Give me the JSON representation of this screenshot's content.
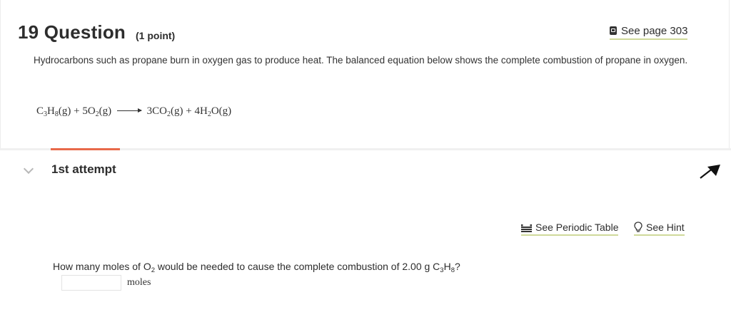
{
  "question": {
    "number": "19 Question",
    "points": "(1 point)",
    "see_page": "See page 303",
    "prompt": "Hydrocarbons such as propane burn in oxygen gas to produce heat. The balanced equation below shows the complete combustion of propane in oxygen.",
    "equation": {
      "reactant1": {
        "a": "C",
        "s1": "3",
        "b": "H",
        "s2": "8",
        "state": "(g)"
      },
      "plus1": "+",
      "reactant2": {
        "coef": "5",
        "a": "O",
        "s1": "2",
        "state": "(g)"
      },
      "product1": {
        "coef": "3",
        "a": "CO",
        "s1": "2",
        "state": "(g)"
      },
      "plus2": "+",
      "product2": {
        "coef": "4",
        "a": "H",
        "s1": "2",
        "b": "O",
        "state": "(g)"
      }
    }
  },
  "attempt": {
    "label": "1st attempt",
    "accent_color": "#e8694a"
  },
  "links": {
    "periodic_table": "See Periodic Table",
    "hint": "See Hint"
  },
  "part": {
    "q_pre": "How many moles of O",
    "q_sub1": "2",
    "q_mid": "would be needed to cause the complete combustion of 2.00  g C",
    "q_sub2": "3",
    "q_h": "H",
    "q_sub3": "8",
    "q_end": "?",
    "answer_value": "",
    "unit": "moles"
  },
  "icons": [
    "book-icon",
    "chevron-down-icon",
    "pointer-icon",
    "periodic-table-icon",
    "lightbulb-icon"
  ]
}
